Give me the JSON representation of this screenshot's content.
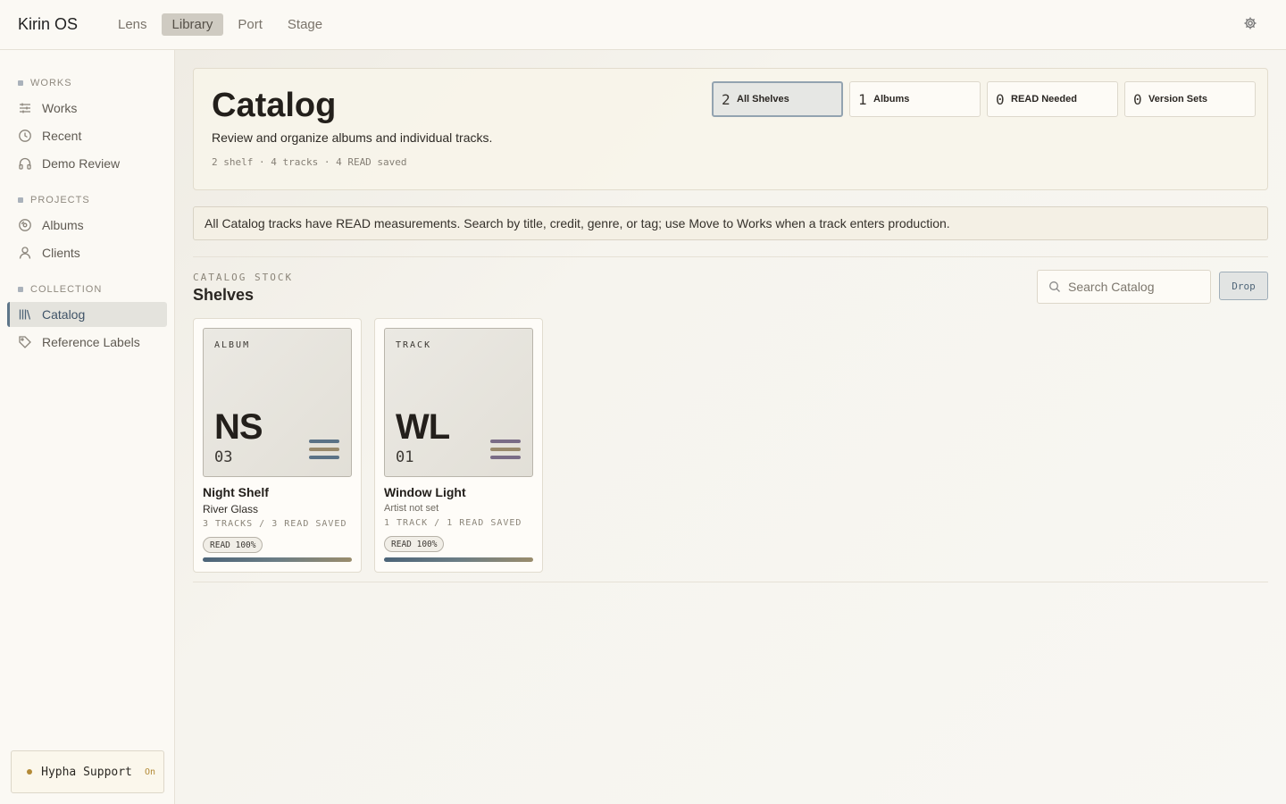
{
  "app": {
    "title": "Kirin OS"
  },
  "topnav": [
    {
      "label": "Lens",
      "active": false
    },
    {
      "label": "Library",
      "active": true
    },
    {
      "label": "Port",
      "active": false
    },
    {
      "label": "Stage",
      "active": false
    }
  ],
  "sidebar": {
    "sections": [
      {
        "title": "WORKS",
        "items": [
          {
            "label": "Works",
            "icon": "sliders-icon"
          },
          {
            "label": "Recent",
            "icon": "clock-icon"
          },
          {
            "label": "Demo Review",
            "icon": "headphones-icon"
          }
        ]
      },
      {
        "title": "PROJECTS",
        "items": [
          {
            "label": "Albums",
            "icon": "disc-icon"
          },
          {
            "label": "Clients",
            "icon": "user-icon"
          }
        ]
      },
      {
        "title": "COLLECTION",
        "items": [
          {
            "label": "Catalog",
            "icon": "library-icon",
            "active": true
          },
          {
            "label": "Reference Labels",
            "icon": "tag-icon"
          }
        ]
      }
    ],
    "support": {
      "label": "Hypha Support",
      "state": "On"
    }
  },
  "hero": {
    "title": "Catalog",
    "subtitle": "Review and organize albums and individual tracks.",
    "meta": "2 shelf · 4 tracks · 4 READ saved",
    "stats": [
      {
        "num": "2",
        "label": "All Shelves",
        "active": true
      },
      {
        "num": "1",
        "label": "Albums",
        "active": false
      },
      {
        "num": "0",
        "label": "READ Needed",
        "active": false
      },
      {
        "num": "0",
        "label": "Version Sets",
        "active": false
      }
    ]
  },
  "notice": "All Catalog tracks have READ measurements. Search by title, credit, genre, or tag; use Move to Works when a track enters production.",
  "shelves": {
    "eyebrow": "CATALOG STOCK",
    "title": "Shelves",
    "search_placeholder": "Search Catalog",
    "drop_label": "Drop",
    "cards": [
      {
        "kind": "ALBUM",
        "initials": "NS",
        "index": "03",
        "title": "Night Shelf",
        "artist": "River Glass",
        "counts": "3 TRACKS / 3 READ SAVED",
        "pill": "READ 100%",
        "read_fraction": 1.0,
        "bar_colors": [
          "#5b7286",
          "#998a6c",
          "#5b7286"
        ]
      },
      {
        "kind": "TRACK",
        "initials": "WL",
        "index": "01",
        "title": "Window Light",
        "artist": "Artist not set",
        "counts": "1 TRACK / 1 READ SAVED",
        "pill": "READ 100%",
        "read_fraction": 1.0,
        "bar_colors": [
          "#7a6c86",
          "#998a6c",
          "#7a6c86"
        ]
      }
    ]
  },
  "colors": {
    "accent": "#5e7689",
    "warm": "#b38a37",
    "background": "#faf8f2"
  }
}
